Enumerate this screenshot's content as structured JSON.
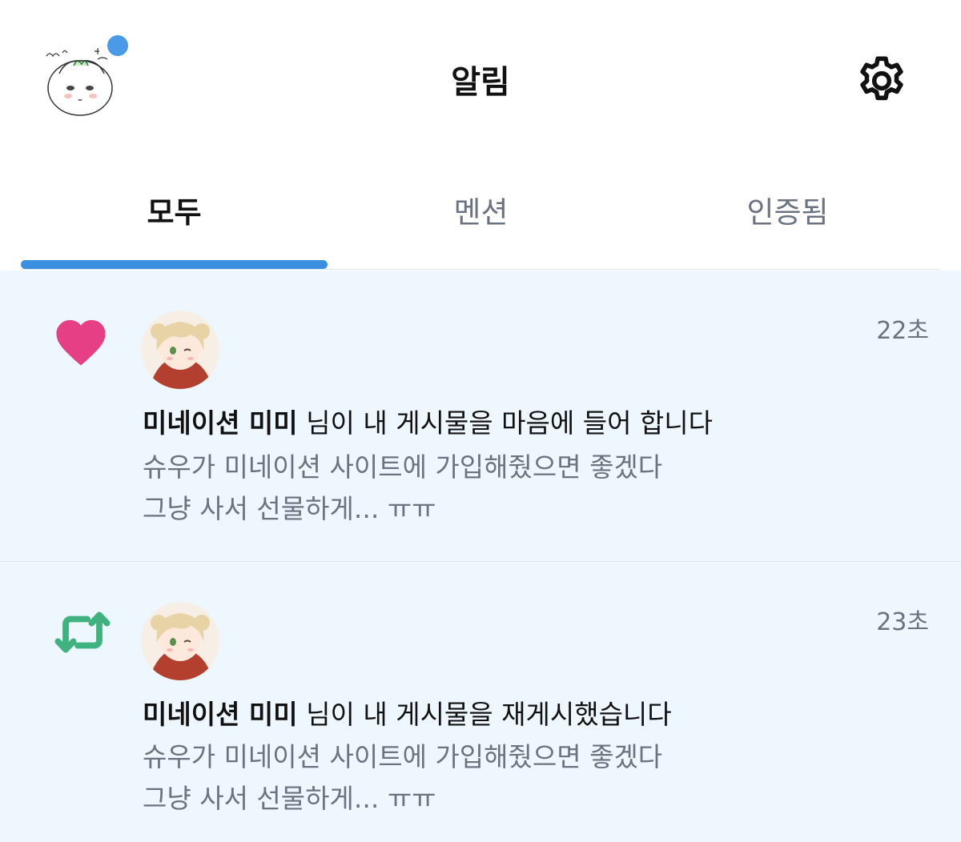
{
  "header": {
    "title": "알림",
    "profile_icon": "profile-sketch-avatar",
    "settings_icon": "gear-icon"
  },
  "tabs": [
    {
      "label": "모두",
      "active": true
    },
    {
      "label": "멘션",
      "active": false
    },
    {
      "label": "인증됨",
      "active": false
    }
  ],
  "colors": {
    "accent": "#3b8fe0",
    "like": "#e63f86",
    "repost": "#3fb27f",
    "unread_bg": "#eef7fe"
  },
  "notifications": [
    {
      "type": "like",
      "icon": "heart-icon",
      "user": "미네이션 미미",
      "action": " 님이 내 게시물을 마음에 들어 합니다",
      "time": "22초",
      "preview_line1": "슈우가 미네이션 사이트에 가입해줬으면 좋겠다",
      "preview_line2": "그냥 사서 선물하게... ㅠㅠ"
    },
    {
      "type": "repost",
      "icon": "repost-icon",
      "user": "미네이션 미미",
      "action": " 님이 내 게시물을 재게시했습니다",
      "time": "23초",
      "preview_line1": "슈우가 미네이션 사이트에 가입해줬으면 좋겠다",
      "preview_line2": "그냥 사서 선물하게... ㅠㅠ"
    }
  ]
}
